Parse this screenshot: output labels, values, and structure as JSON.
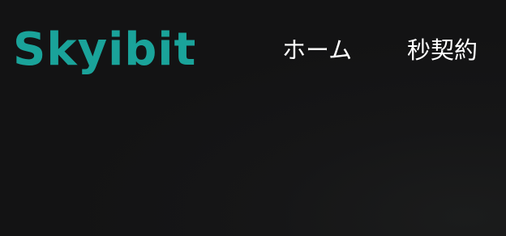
{
  "header": {
    "logo_text": "Skyibit",
    "nav": [
      {
        "label": "ホーム"
      },
      {
        "label": "秒契約"
      }
    ]
  },
  "colors": {
    "background": "#131314",
    "logo": "#1aa39a",
    "nav_text": "#ffffff"
  }
}
